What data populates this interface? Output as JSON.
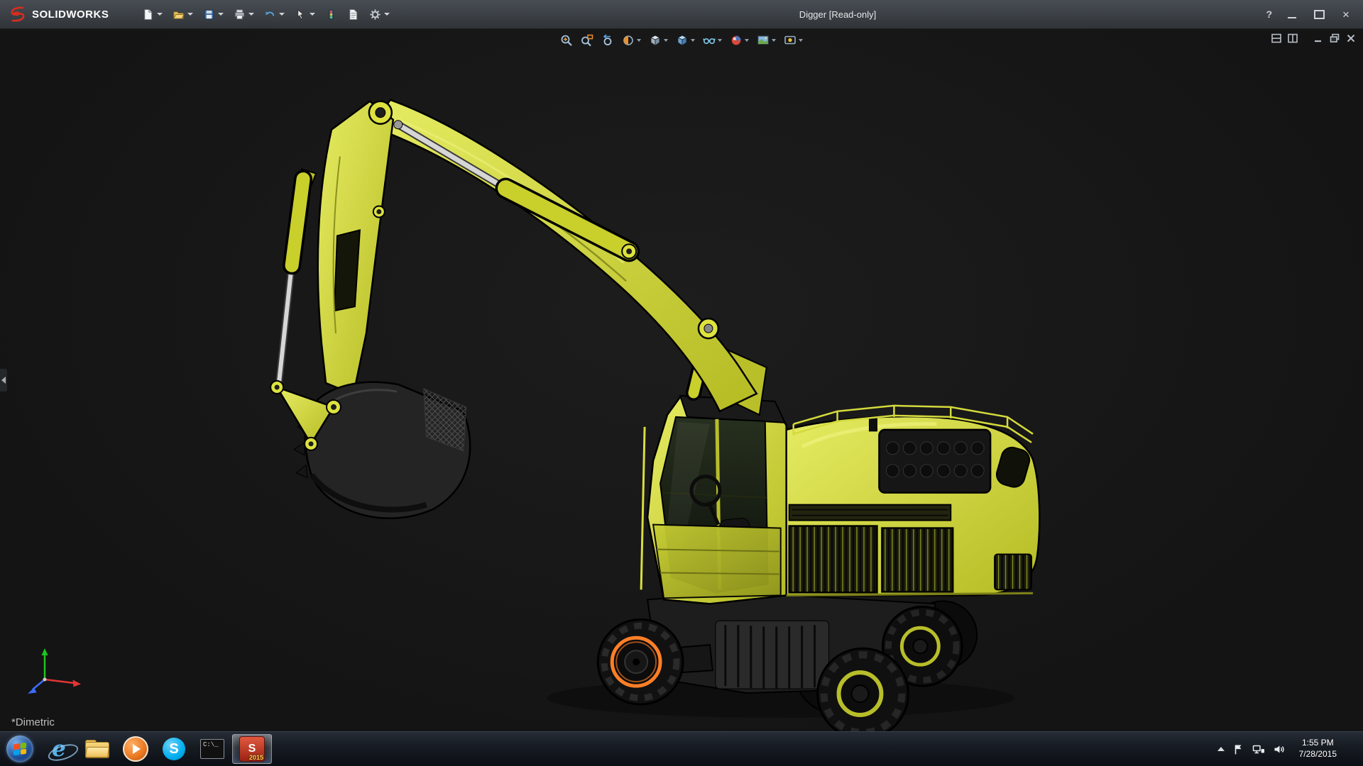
{
  "colors": {
    "titlebar_bg_top": "#484d53",
    "titlebar_bg_bottom": "#303439",
    "viewport_bg": "#141414",
    "model_yellow": "#cdd32e",
    "model_yellow_dark": "#a6ac20",
    "model_yellow_light": "#e9ee6e",
    "selection_orange": "#ff7f27",
    "taskbar_bg_top": "#262c36",
    "taskbar_bg_bottom": "#0c0f14"
  },
  "titlebar": {
    "app_name": "SOLIDWORKS",
    "document_title": "Digger [Read-only]",
    "help_label": "?",
    "tools": [
      "new-document",
      "open",
      "save",
      "print",
      "undo",
      "select",
      "rebuild",
      "file-properties",
      "options"
    ]
  },
  "headsup_toolbar": {
    "tools": [
      "zoom-to-fit",
      "zoom-to-area",
      "previous-view",
      "section-view",
      "view-orientation",
      "display-style",
      "hide-show-items",
      "edit-appearance",
      "apply-scene",
      "view-settings"
    ]
  },
  "document_window": {
    "controls": [
      "tile-horizontally",
      "tile-vertically",
      "minimize",
      "restore",
      "close"
    ]
  },
  "viewport": {
    "view_orientation_label": "*Dimetric"
  },
  "taskbar": {
    "items": [
      "start",
      "internet-explorer",
      "windows-explorer",
      "media-player",
      "skype",
      "command-prompt",
      "solidworks-2015"
    ],
    "active_item": "solidworks-2015",
    "ie_letter": "e",
    "skype_letter": "S",
    "sw_letter": "S",
    "sw_badge": "2015",
    "cmd_label": "C:\\_",
    "tray": {
      "time": "1:55 PM",
      "date": "7/28/2015"
    }
  }
}
